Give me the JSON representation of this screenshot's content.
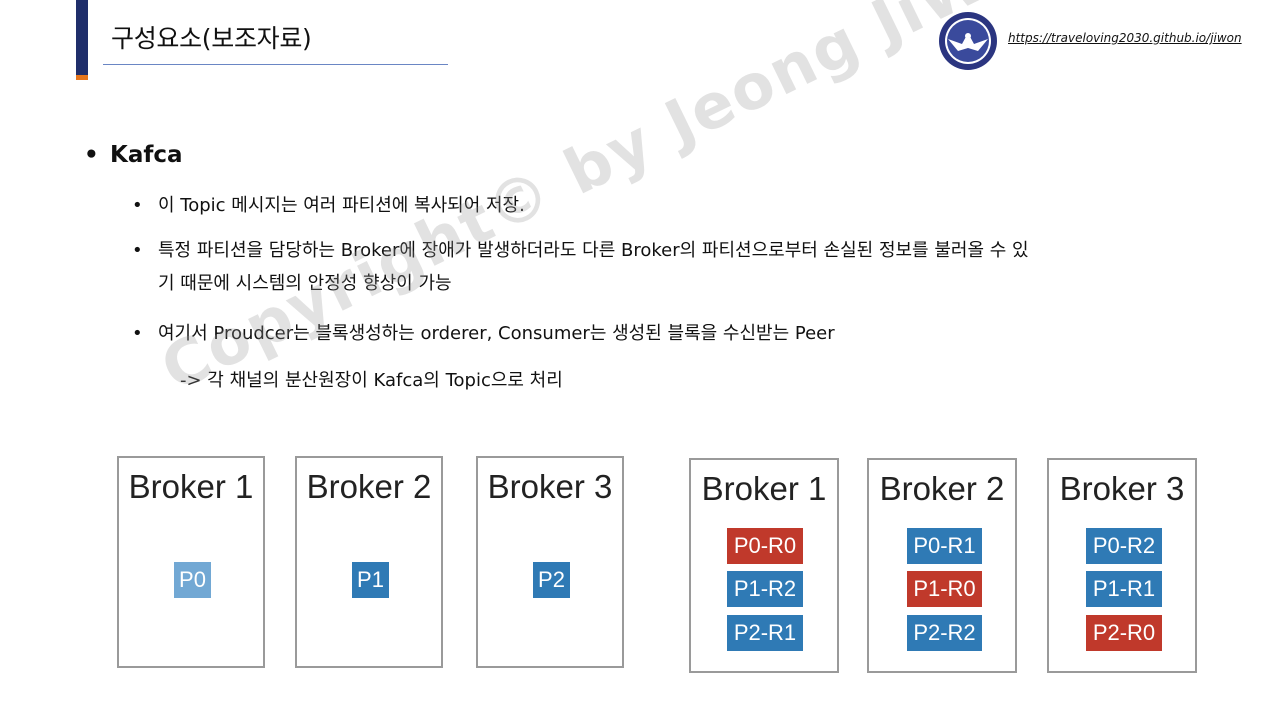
{
  "header": {
    "title": "구성요소(보조자료)",
    "url": "https://traveloving2030.github.io/jiwon"
  },
  "logo": {
    "icon": "eagle-emblem-icon"
  },
  "content": {
    "main_bullet": "Kafca",
    "bullets": [
      {
        "text": "이 Topic 메시지는 여러 파티션에 복사되어 저장."
      },
      {
        "text": "특정 파티션을 담당하는 Broker에 장애가 발생하더라도 다른 Broker의 파티션으로부터 손실된 정보를 불러올 수 있기 때문에 시스템의 안정성 향상이 가능"
      },
      {
        "text": "여기서 Proudcer는 블록생성하는 orderer, Consumer는 생성된 블록을 수신받는 Peer"
      }
    ],
    "sub_line": "-> 각 채널의 분산원장이 Kafca의 Topic으로 처리"
  },
  "watermark": "Copyright© by Jeong JiWon",
  "colors": {
    "accent": "#1f2e6b",
    "orange": "#e6761c",
    "blue": "#2f7ab5",
    "light_blue": "#72a8d4",
    "red": "#c0392b"
  },
  "diagram_left": {
    "brokers": [
      {
        "name": "Broker 1",
        "partitions": [
          {
            "label": "P0",
            "kind": "light"
          }
        ]
      },
      {
        "name": "Broker 2",
        "partitions": [
          {
            "label": "P1",
            "kind": "blue"
          }
        ]
      },
      {
        "name": "Broker 3",
        "partitions": [
          {
            "label": "P2",
            "kind": "blue"
          }
        ]
      }
    ]
  },
  "diagram_right": {
    "brokers": [
      {
        "name": "Broker 1",
        "partitions": [
          {
            "label": "P0-R0",
            "kind": "red"
          },
          {
            "label": "P1-R2",
            "kind": "blue"
          },
          {
            "label": "P2-R1",
            "kind": "blue"
          }
        ]
      },
      {
        "name": "Broker 2",
        "partitions": [
          {
            "label": "P0-R1",
            "kind": "blue"
          },
          {
            "label": "P1-R0",
            "kind": "red"
          },
          {
            "label": "P2-R2",
            "kind": "blue"
          }
        ]
      },
      {
        "name": "Broker 3",
        "partitions": [
          {
            "label": "P0-R2",
            "kind": "blue"
          },
          {
            "label": "P1-R1",
            "kind": "blue"
          },
          {
            "label": "P2-R0",
            "kind": "red"
          }
        ]
      }
    ]
  }
}
